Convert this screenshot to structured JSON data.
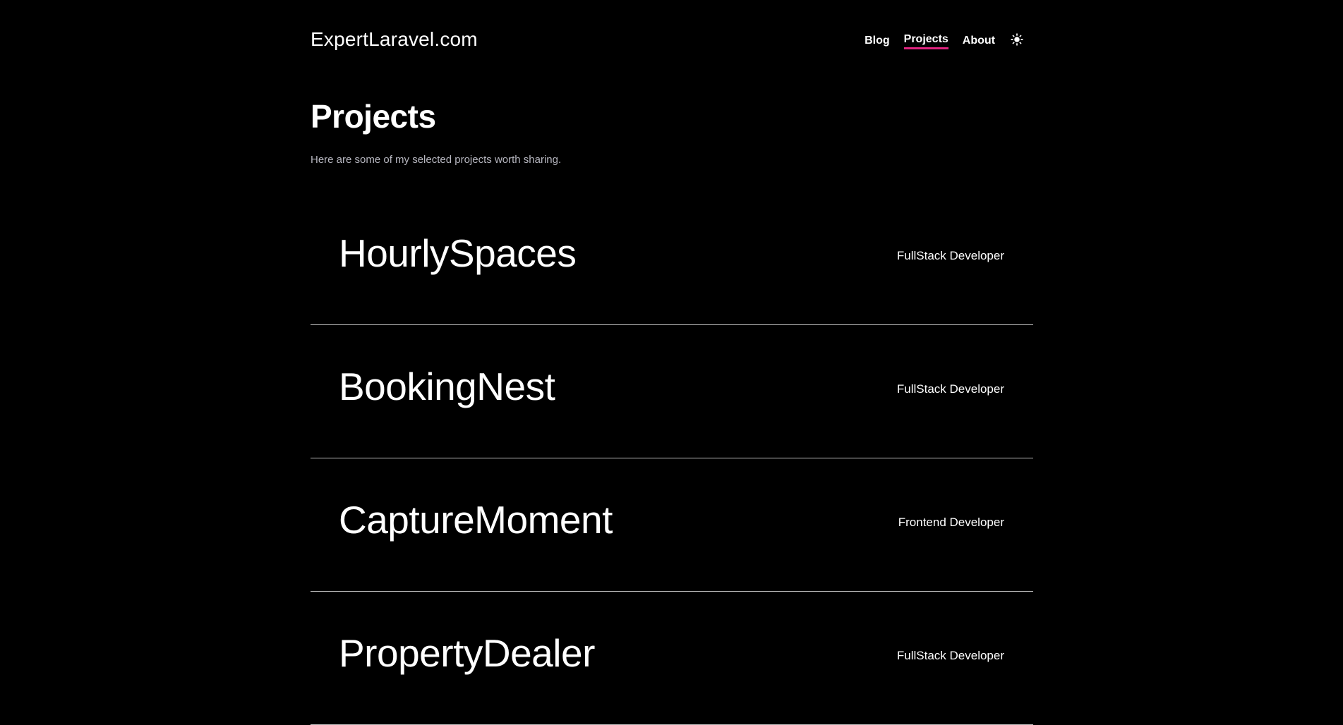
{
  "header": {
    "logo": "ExpertLaravel.com",
    "nav": [
      {
        "label": "Blog",
        "active": false
      },
      {
        "label": "Projects",
        "active": true
      },
      {
        "label": "About",
        "active": false
      }
    ],
    "theme_toggle_icon": "sun-icon",
    "accent_color": "#e0247f"
  },
  "main": {
    "title": "Projects",
    "subtitle": "Here are some of my selected projects worth sharing.",
    "projects": [
      {
        "name": "HourlySpaces",
        "role": "FullStack Developer"
      },
      {
        "name": "BookingNest",
        "role": "FullStack Developer"
      },
      {
        "name": "CaptureMoment",
        "role": "Frontend Developer"
      },
      {
        "name": "PropertyDealer",
        "role": "FullStack Developer"
      }
    ]
  }
}
